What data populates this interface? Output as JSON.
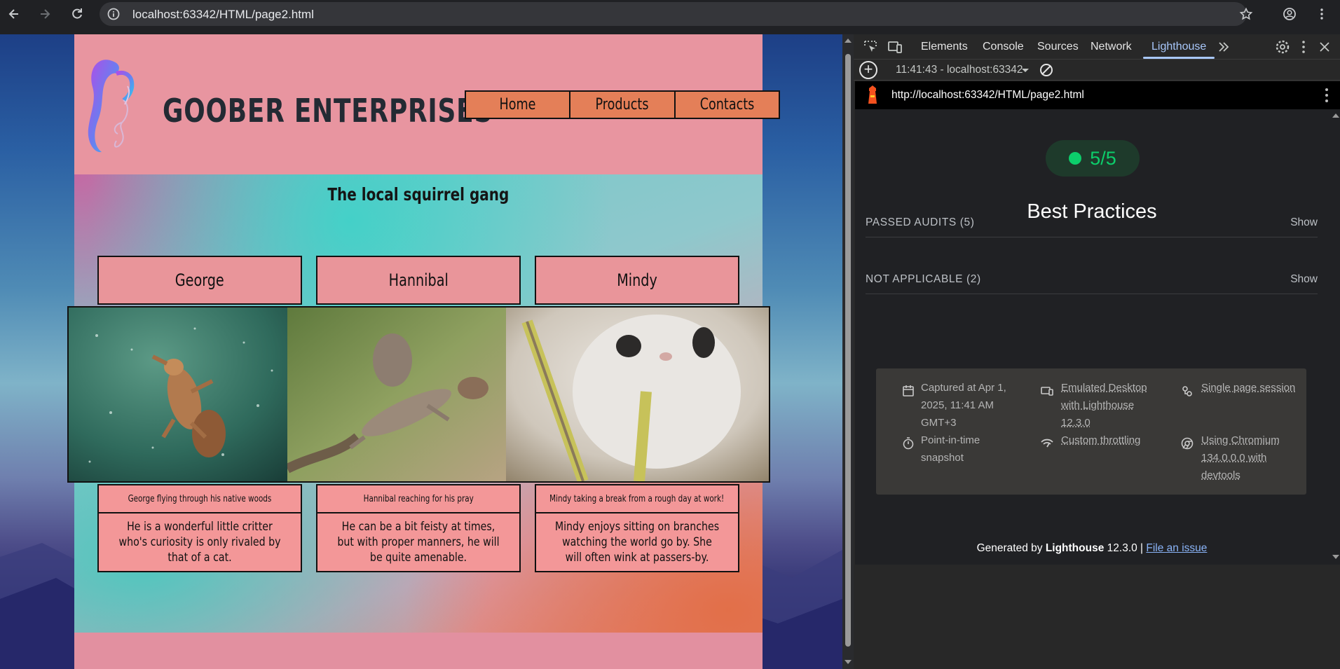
{
  "browser": {
    "url": "localhost:63342/HTML/page2.html"
  },
  "site": {
    "brand": "GOOBER ENTERPRISES",
    "nav": [
      "Home",
      "Products",
      "Contacts"
    ],
    "section_title": "The local squirrel gang",
    "squirrels": [
      {
        "name": "George",
        "caption": "George flying through his native woods",
        "description": "He is a wonderful little critter who's curiosity is only rivaled by that of a cat."
      },
      {
        "name": "Hannibal",
        "caption": "Hannibal reaching for his pray",
        "description": "He can be a bit feisty at times, but with proper manners, he will be quite amenable."
      },
      {
        "name": "Mindy",
        "caption": "Mindy taking a break from a rough day at work!",
        "description": "Mindy enjoys sitting on branches watching the world go by. She will often wink at passers-by."
      }
    ]
  },
  "devtools": {
    "tabs": [
      "Elements",
      "Console",
      "Sources",
      "Network",
      "Lighthouse"
    ],
    "active_tab": "Lighthouse",
    "report_selector": "11:41:43 - localhost:63342",
    "report_url": "http://localhost:63342/HTML/page2.html",
    "score": "5/5",
    "score_color": "#0cce6b",
    "category_title": "Best Practices",
    "sections": [
      {
        "label": "PASSED AUDITS (5)",
        "action": "Show"
      },
      {
        "label": "NOT APPLICABLE (2)",
        "action": "Show"
      }
    ],
    "meta": {
      "captured_1": "Captured at Apr 1,",
      "captured_2": "2025, 11:41 AM",
      "captured_3": "GMT+3",
      "emulated_1": "Emulated Desktop",
      "emulated_2": "with Lighthouse",
      "emulated_3": "12.3.0",
      "session": "Single page session",
      "snapshot_1": "Point-in-time",
      "snapshot_2": "snapshot",
      "throttling": "Custom throttling",
      "chromium_1": "Using Chromium",
      "chromium_2": "134.0.0.0 with",
      "chromium_3": "devtools"
    },
    "footer": {
      "prefix": "Generated by ",
      "product": "Lighthouse",
      "version": " 12.3.0 | ",
      "link": "File an issue"
    }
  }
}
